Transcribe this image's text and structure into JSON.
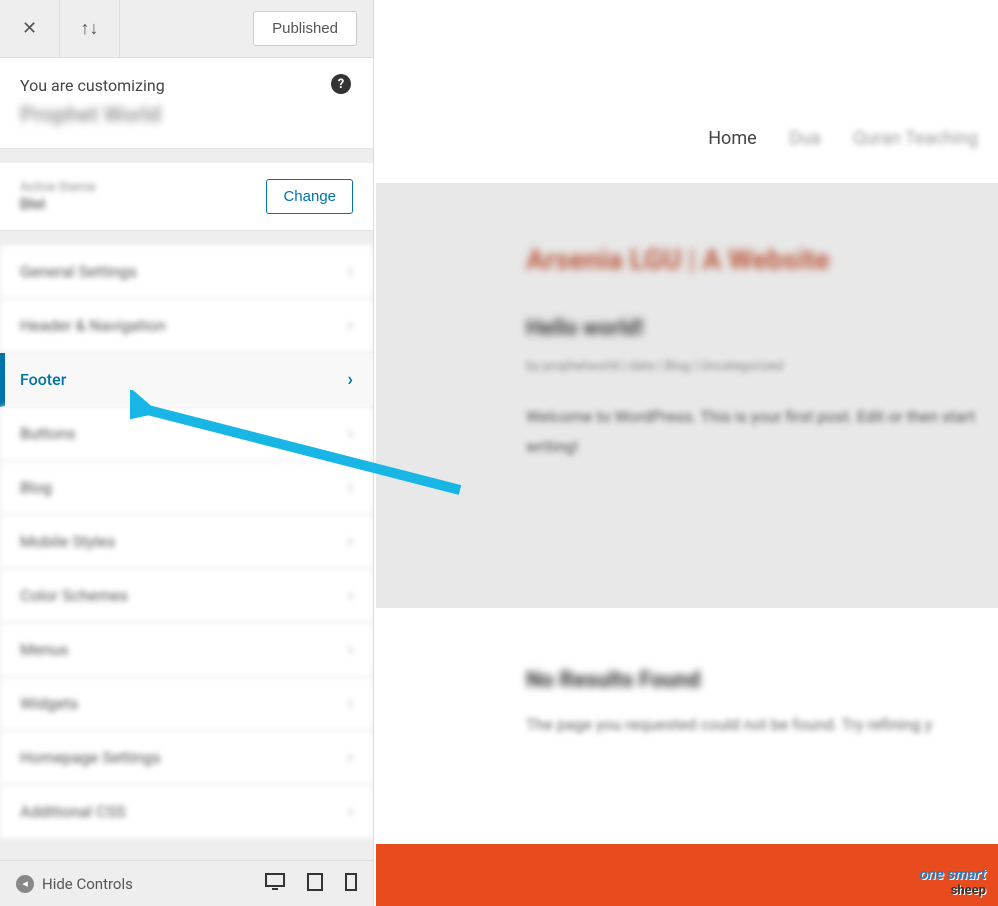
{
  "header": {
    "published_label": "Published"
  },
  "customizing": {
    "label": "You are customizing",
    "site_name": "Prophet World"
  },
  "theme": {
    "active_label": "Active theme",
    "name": "Divi",
    "change_label": "Change"
  },
  "menu": [
    {
      "label": "General Settings",
      "active": false,
      "blurred": true
    },
    {
      "label": "Header & Navigation",
      "active": false,
      "blurred": true
    },
    {
      "label": "Footer",
      "active": true,
      "blurred": false
    },
    {
      "label": "Buttons",
      "active": false,
      "blurred": true
    },
    {
      "label": "Blog",
      "active": false,
      "blurred": true
    },
    {
      "label": "Mobile Styles",
      "active": false,
      "blurred": true
    },
    {
      "label": "Color Schemes",
      "active": false,
      "blurred": true
    },
    {
      "label": "Menus",
      "active": false,
      "blurred": true
    },
    {
      "label": "Widgets",
      "active": false,
      "blurred": true
    },
    {
      "label": "Homepage Settings",
      "active": false,
      "blurred": true
    },
    {
      "label": "Additional CSS",
      "active": false,
      "blurred": true
    }
  ],
  "bottom": {
    "hide_label": "Hide Controls"
  },
  "preview": {
    "nav": [
      "Home",
      "Dua",
      "Quran Teaching"
    ],
    "hero_title": "Arsenia LGU | A Website",
    "hero_sub": "Hello world!",
    "hero_meta": "by prophetworld | date | Blog | Uncategorized",
    "hero_text": "Welcome to WordPress. This is your first post. Edit or then start writing!",
    "nr_title": "No Results Found",
    "nr_text": "The page you requested could not be found. Try refining y"
  },
  "watermark": {
    "line1": "one smart",
    "line2": "sheep"
  },
  "colors": {
    "accent": "#0073aa",
    "arrow": "#17b6e5",
    "footer": "#e84b1e"
  }
}
